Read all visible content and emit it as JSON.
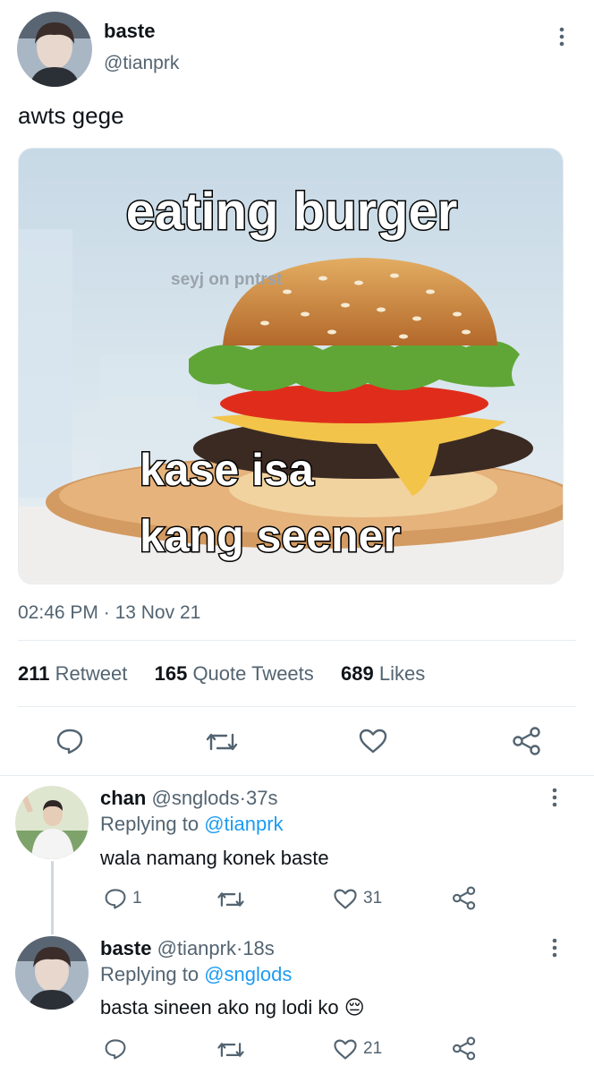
{
  "tweet": {
    "author_name": "baste",
    "author_handle": "@tianprk",
    "text": "awts gege",
    "image": {
      "top_text": "eating burger",
      "watermark": "seyj on pntrst",
      "bottom_text_line1": "kase isa",
      "bottom_text_line2": "kang seener"
    },
    "time": "02:46 PM",
    "separator": "·",
    "date": "13 Nov 21",
    "stats": {
      "retweets_count": "211",
      "retweets_label": "Retweet",
      "quotes_count": "165",
      "quotes_label": "Quote Tweets",
      "likes_count": "689",
      "likes_label": "Likes"
    }
  },
  "replies": [
    {
      "name": "chan",
      "handle": "@snglods",
      "sep": "·",
      "time": "37s",
      "replying_prefix": "Replying to",
      "replying_to": "@tianprk",
      "text": "wala namang konek baste",
      "reply_count": "1",
      "retweet_count": "",
      "like_count": "31"
    },
    {
      "name": "baste",
      "handle": "@tianprk",
      "sep": "·",
      "time": "18s",
      "replying_prefix": "Replying to",
      "replying_to": "@snglods",
      "text": "basta sineen ako ng lodi ko",
      "emoji": "😔",
      "reply_count": "",
      "retweet_count": "",
      "like_count": "21"
    }
  ],
  "colors": {
    "accent": "#1d9bf0",
    "muted": "#536471",
    "text": "#0f1419",
    "divider": "#e6ecf0"
  }
}
